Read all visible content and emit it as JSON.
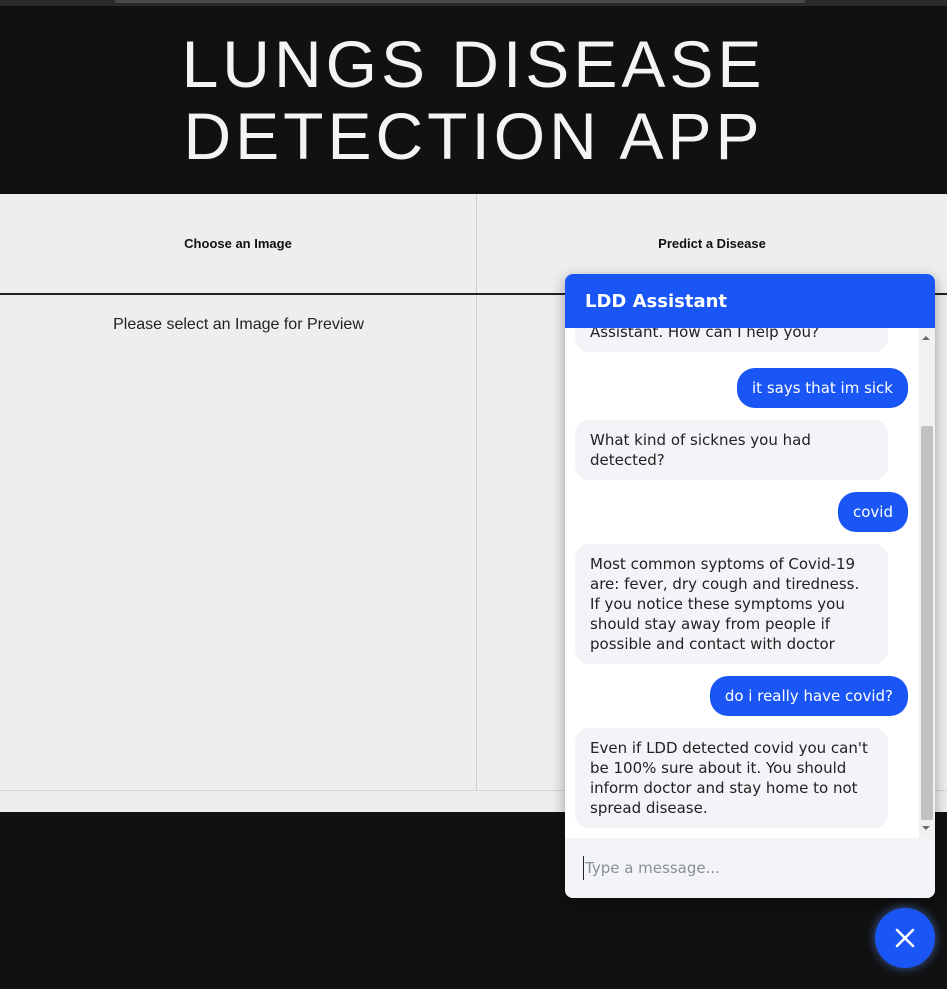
{
  "header": {
    "title": "LUNGS DISEASE DETECTION APP"
  },
  "tabs": {
    "left_label": "Choose an Image",
    "right_label": "Predict a Disease"
  },
  "preview": {
    "placeholder_text": "Please select an Image for Preview"
  },
  "chat": {
    "title": "LDD Assistant",
    "messages": [
      {
        "from": "bot",
        "text": "Assistant. How can I help you?"
      },
      {
        "from": "user",
        "text": "it says that im sick"
      },
      {
        "from": "bot",
        "text": "What kind of sicknes you had detected?"
      },
      {
        "from": "user",
        "text": "covid"
      },
      {
        "from": "bot",
        "text": "Most common syptoms of Covid-19 are: fever, dry cough and tiredness. If you notice these symptoms you should stay away from people if possible and contact with doctor"
      },
      {
        "from": "user",
        "text": "do i really have covid?"
      },
      {
        "from": "bot",
        "text": "Even if LDD detected covid you can't be 100% sure about it. You should inform doctor and stay home to not spread disease."
      }
    ],
    "input_placeholder": "Type a message...",
    "close_icon": "close-icon"
  },
  "colors": {
    "accent": "#1a56f5",
    "background": "#111111",
    "panel": "#eeeeee"
  }
}
